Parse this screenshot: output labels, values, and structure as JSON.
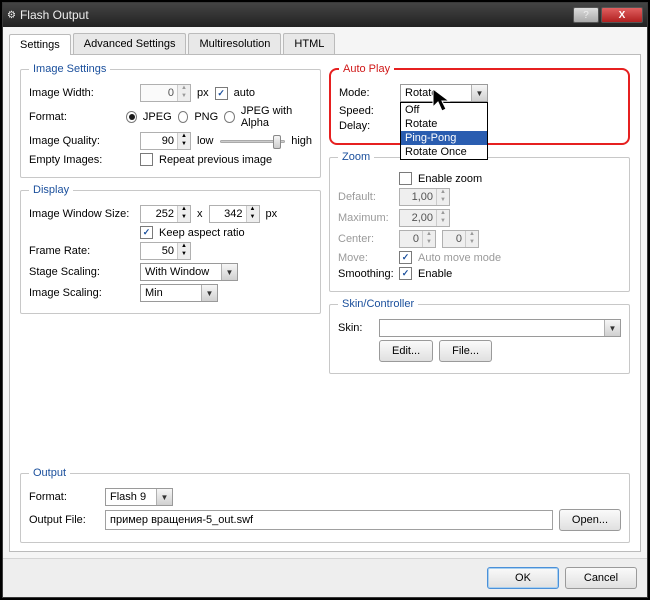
{
  "window": {
    "title": "Flash Output",
    "btn_help": "?",
    "btn_close": "X"
  },
  "tabs": [
    "Settings",
    "Advanced Settings",
    "Multiresolution",
    "HTML"
  ],
  "image_settings": {
    "title": "Image Settings",
    "width_label": "Image Width:",
    "width": "0",
    "px": "px",
    "auto": "auto",
    "format_label": "Format:",
    "jpeg": "JPEG",
    "png": "PNG",
    "jpeg_alpha": "JPEG with Alpha",
    "quality_label": "Image Quality:",
    "quality": "90",
    "low": "low",
    "high": "high",
    "empty_label": "Empty Images:",
    "repeat": "Repeat previous image"
  },
  "display": {
    "title": "Display",
    "wsize_label": "Image Window Size:",
    "w": "252",
    "x": "x",
    "h": "342",
    "px": "px",
    "keep_aspect": "Keep aspect ratio",
    "framerate_label": "Frame Rate:",
    "framerate": "50",
    "stagescale_label": "Stage Scaling:",
    "stagescale": "With Window",
    "imgscale_label": "Image Scaling:",
    "imgscale": "Min"
  },
  "autoplay": {
    "title": "Auto Play",
    "mode_label": "Mode:",
    "mode": "Rotate",
    "options": [
      "Off",
      "Rotate",
      "Ping-Pong",
      "Rotate Once"
    ],
    "speed_label": "Speed:",
    "delay_label": "Delay:"
  },
  "zoom": {
    "title": "Zoom",
    "enable": "Enable zoom",
    "default_label": "Default:",
    "default": "1,00",
    "max_label": "Maximum:",
    "max": "2,00",
    "center_label": "Center:",
    "cx": "0",
    "cy": "0",
    "move_label": "Move:",
    "automove": "Auto move mode",
    "smooth_label": "Smoothing:",
    "smooth_enable": "Enable"
  },
  "skin": {
    "title": "Skin/Controller",
    "label": "Skin:",
    "edit": "Edit...",
    "file": "File..."
  },
  "output": {
    "title": "Output",
    "format_label": "Format:",
    "format": "Flash 9",
    "file_label": "Output File:",
    "file": "пример вращения-5_out.swf",
    "open": "Open..."
  },
  "footer": {
    "ok": "OK",
    "cancel": "Cancel"
  }
}
